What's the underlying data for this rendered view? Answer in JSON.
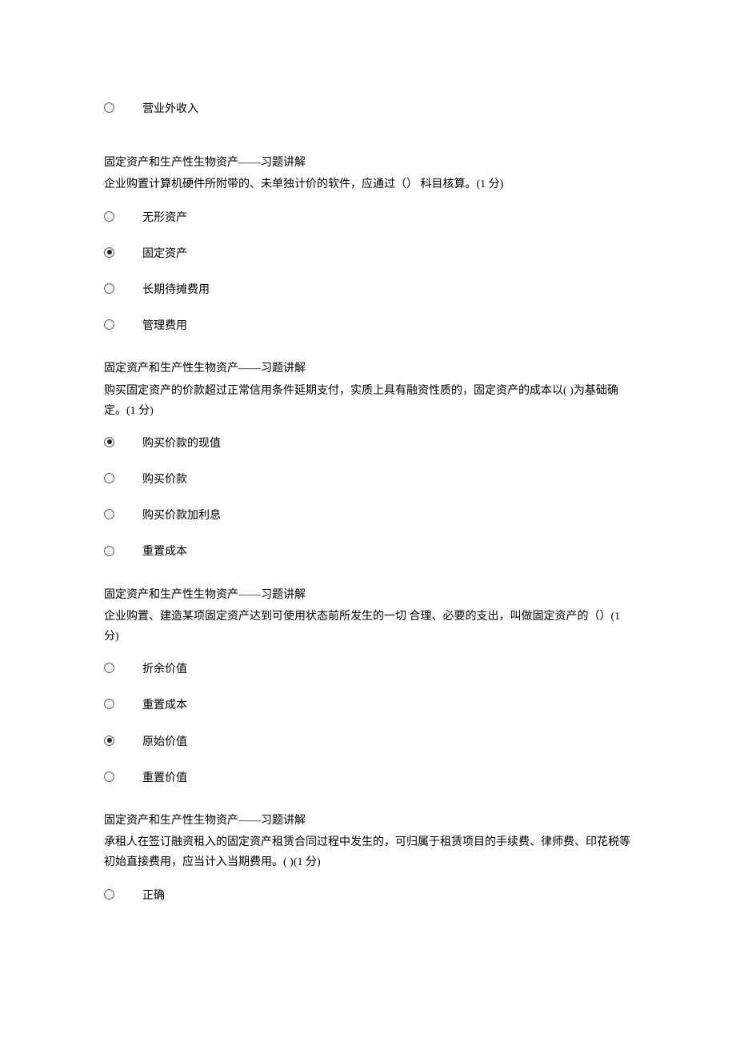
{
  "q0": {
    "options": [
      {
        "label": "营业外收入",
        "selected": false
      }
    ]
  },
  "q1": {
    "section": "固定资产和生产性生物资产——习题讲解",
    "text": "企业购置计算机硬件所附带的、未单独计价的软件，应通过（）  科目核算。(1 分)",
    "options": [
      {
        "label": "无形资产",
        "selected": false
      },
      {
        "label": "固定资产",
        "selected": true
      },
      {
        "label": "长期待摊费用",
        "selected": false
      },
      {
        "label": "管理费用",
        "selected": false
      }
    ]
  },
  "q2": {
    "section": "固定资产和生产性生物资产——习题讲解",
    "text": "购买固定资产的价款超过正常信用条件延期支付，实质上具有融资性质的，固定资产的成本以(   )为基础确定。(1 分)",
    "options": [
      {
        "label": "购买价款的现值",
        "selected": true
      },
      {
        "label": "购买价款",
        "selected": false
      },
      {
        "label": "购买价款加利息",
        "selected": false
      },
      {
        "label": "重置成本",
        "selected": false
      }
    ]
  },
  "q3": {
    "section": "固定资产和生产性生物资产——习题讲解",
    "text": "企业购置、建造某项固定资产达到可使用状态前所发生的一切  合理、必要的支出，叫做固定资产的（）(1 分)",
    "options": [
      {
        "label": "折余价值",
        "selected": false
      },
      {
        "label": "重置成本",
        "selected": false
      },
      {
        "label": "原始价值",
        "selected": true
      },
      {
        "label": "重置价值",
        "selected": false
      }
    ]
  },
  "q4": {
    "section": "固定资产和生产性生物资产——习题讲解",
    "text": "承租人在签订融资租入的固定资产租赁合同过程中发生的，可归属于租赁项目的手续费、律师费、印花税等初始直接费用，应当计入当期费用。( )(1 分)",
    "options": [
      {
        "label": "正确",
        "selected": false
      }
    ]
  }
}
